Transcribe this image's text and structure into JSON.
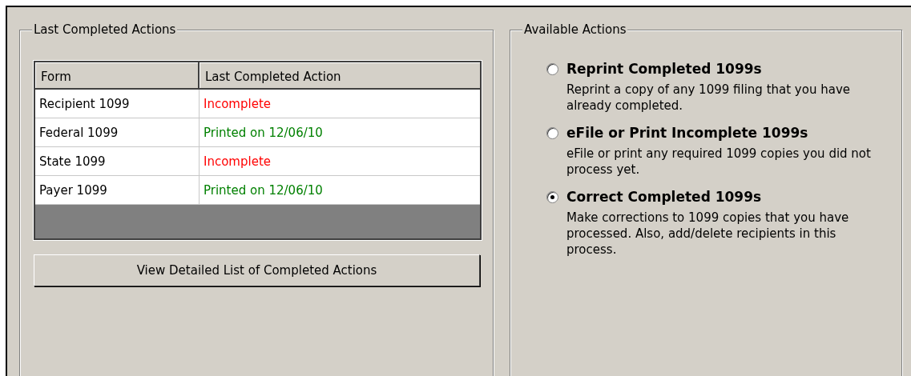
{
  "last_completed": {
    "title": "Last Completed Actions",
    "table": {
      "columns": [
        "Form",
        "Last Completed Action"
      ],
      "rows": [
        {
          "form": "Recipient 1099",
          "action": "Incomplete",
          "color": "#ff0000"
        },
        {
          "form": "Federal 1099",
          "action": "Printed on 12/06/10",
          "color": "#008000"
        },
        {
          "form": "State 1099",
          "action": "Incomplete",
          "color": "#ff0000"
        },
        {
          "form": "Payer 1099",
          "action": "Printed on 12/06/10",
          "color": "#008000"
        }
      ]
    },
    "button": "View Detailed List of Completed Actions"
  },
  "available": {
    "title": "Available Actions",
    "options": [
      {
        "label": "Reprint Completed 1099s",
        "description": "Reprint a copy of any 1099 filing that you have already completed.",
        "selected": false
      },
      {
        "label": "eFile or Print Incomplete 1099s",
        "description": "eFile or print any required 1099 copies you did not process yet.",
        "selected": false
      },
      {
        "label": "Correct Completed 1099s",
        "description": "Make corrections to 1099 copies that you have processed. Also, add/delete recipients in this process.",
        "selected": true
      }
    ]
  }
}
